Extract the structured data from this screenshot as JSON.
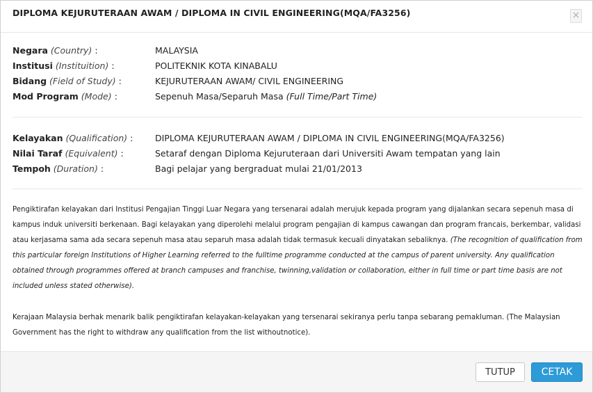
{
  "modal": {
    "title": "DIPLOMA KEJURUTERAAN AWAM / DIPLOMA IN CIVIL ENGINEERING(MQA/FA3256)",
    "close_label": "×"
  },
  "info1": [
    {
      "label": "Negara",
      "label_en": "(Country)",
      "sep": ":",
      "value": "MALAYSIA",
      "value_en": ""
    },
    {
      "label": "Institusi",
      "label_en": "(Instituition)",
      "sep": ":",
      "value": "POLITEKNIK KOTA KINABALU",
      "value_en": ""
    },
    {
      "label": "Bidang",
      "label_en": "(Field of Study)",
      "sep": ":",
      "value": "KEJURUTERAAN AWAM/ CIVIL ENGINEERING",
      "value_en": ""
    },
    {
      "label": "Mod Program",
      "label_en": "(Mode)",
      "sep": ":",
      "value": "Sepenuh Masa/Separuh Masa",
      "value_en": "(Full Time/Part Time)"
    }
  ],
  "info2": [
    {
      "label": "Kelayakan",
      "label_en": "(Qualification)",
      "sep": ":",
      "value": "DIPLOMA KEJURUTERAAN AWAM / DIPLOMA IN CIVIL ENGINEERING(MQA/FA3256)",
      "value_en": ""
    },
    {
      "label": "Nilai Taraf",
      "label_en": "(Equivalent)",
      "sep": ":",
      "value": "Setaraf dengan Diploma Kejuruteraan dari Universiti Awam tempatan yang lain",
      "value_en": ""
    },
    {
      "label": "Tempoh",
      "label_en": "(Duration)",
      "sep": ":",
      "value": "Bagi pelajar yang bergraduat mulai 21/01/2013",
      "value_en": ""
    }
  ],
  "notes": {
    "para1_ms": "Pengiktirafan kelayakan dari Institusi Pengajian Tinggi Luar Negara yang tersenarai adalah merujuk kepada program yang dijalankan secara sepenuh masa di kampus induk universiti berkenaan. Bagi kelayakan yang diperolehi melalui program pengajian di kampus cawangan dan program francais, berkembar, validasi atau kerjasama sama ada secara sepenuh masa atau separuh masa adalah tidak termasuk kecuali dinyatakan sebaliknya.",
    "para1_en": "(The recognition of qualification from this particular foreign Institutions of Higher Learning referred to the fulltime programme conducted at the campus of parent university. Any qualification obtained through programmes offered at branch campuses and franchise, twinning,validation or collaboration, either in full time or part time basis are not included unless stated otherwise).",
    "para2": "Kerajaan Malaysia berhak menarik balik pengiktirafan kelayakan-kelayakan yang tersenarai sekiranya perlu tanpa sebarang pemakluman. (The Malaysian Government has the right to withdraw any qualification from the list withoutnotice)."
  },
  "footer": {
    "tutup_label": "TUTUP",
    "cetak_label": "CETAK"
  },
  "colors": {
    "primary_button": "#2d9bd8",
    "footer_bg": "#f5f5f5"
  }
}
